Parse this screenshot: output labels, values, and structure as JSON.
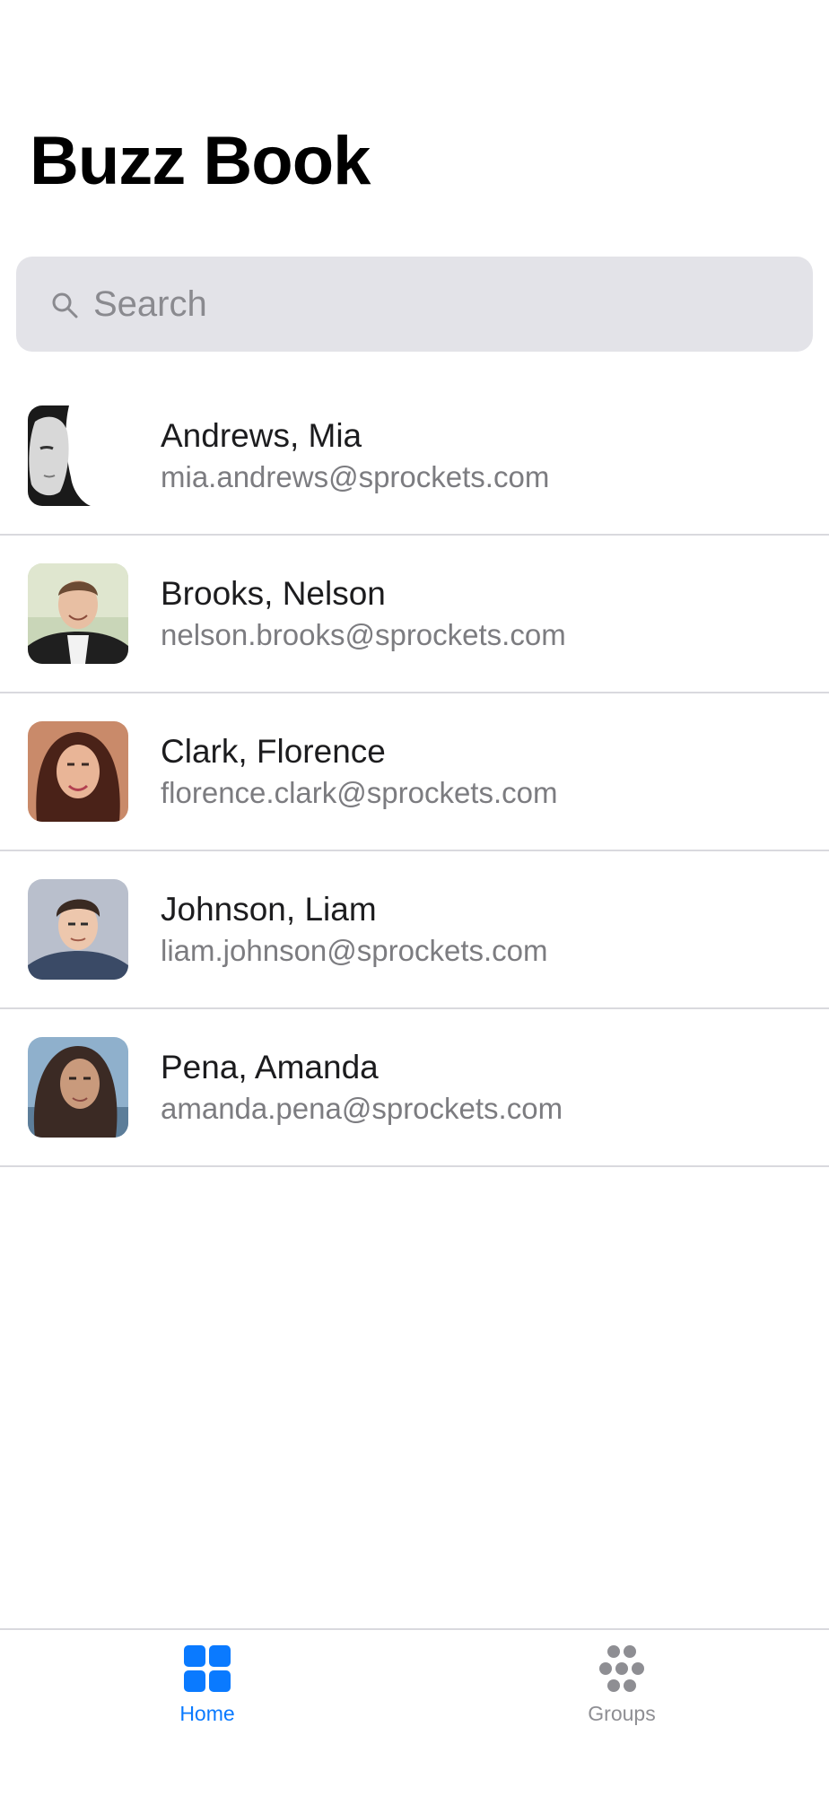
{
  "app": {
    "title": "Buzz Book"
  },
  "search": {
    "placeholder": "Search",
    "icon": "search-icon"
  },
  "contacts": [
    {
      "name": "Andrews, Mia",
      "email": "mia.andrews@sprockets.com"
    },
    {
      "name": "Brooks, Nelson",
      "email": "nelson.brooks@sprockets.com"
    },
    {
      "name": "Clark, Florence",
      "email": "florence.clark@sprockets.com"
    },
    {
      "name": "Johnson, Liam",
      "email": "liam.johnson@sprockets.com"
    },
    {
      "name": "Pena, Amanda",
      "email": "amanda.pena@sprockets.com"
    }
  ],
  "tabbar": {
    "home": {
      "label": "Home",
      "icon": "grid-icon",
      "active": true
    },
    "groups": {
      "label": "Groups",
      "icon": "groups-dots-icon",
      "active": false
    }
  },
  "colors": {
    "accent": "#0a7aff",
    "inactive_tab": "#8e8e93",
    "search_bg": "#e3e3e8",
    "secondary_text": "#7c7c80"
  }
}
